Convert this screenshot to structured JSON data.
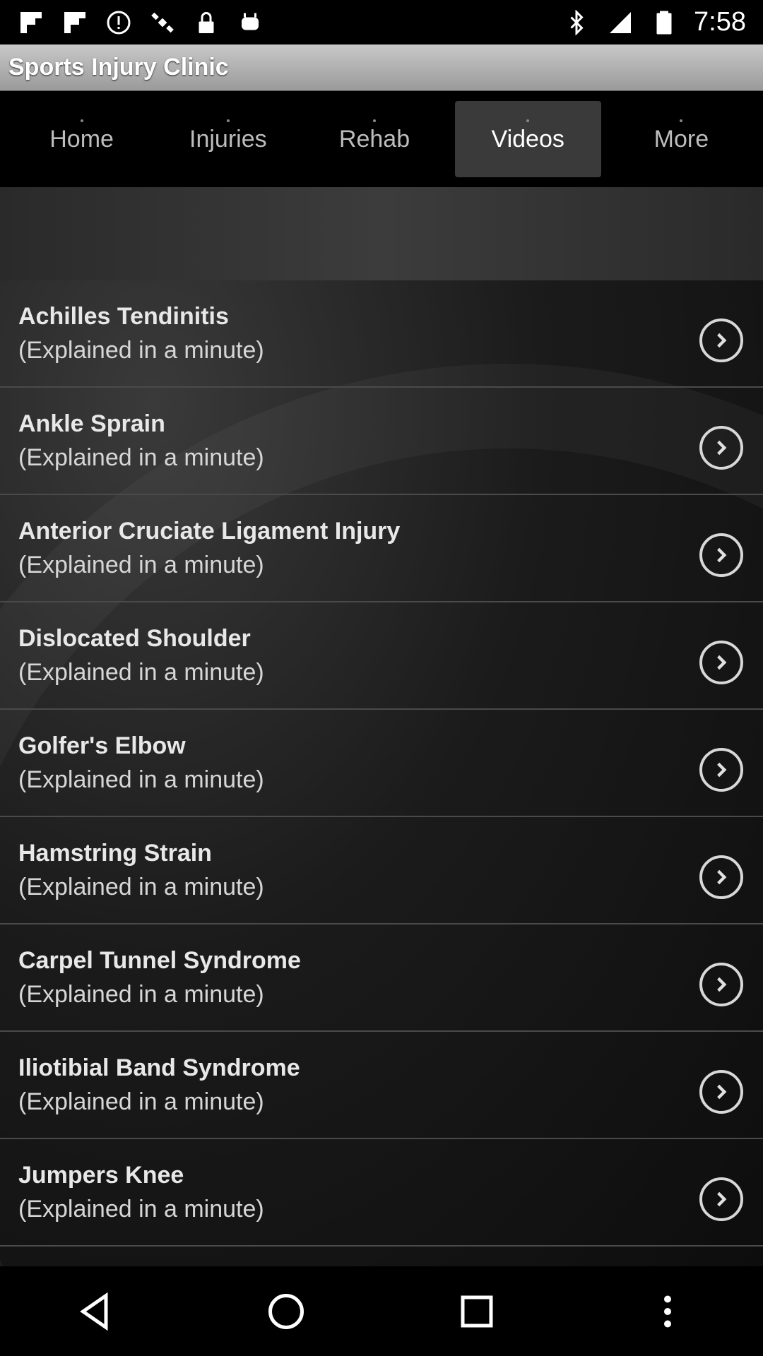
{
  "status_bar": {
    "time": "7:58",
    "left_icons": [
      "flipboard-icon",
      "flipboard-icon",
      "alert-icon",
      "satellite-icon",
      "lock-icon",
      "android-icon"
    ],
    "right_icons": [
      "bluetooth-icon",
      "signal-icon",
      "battery-icon"
    ]
  },
  "app": {
    "title": "Sports Injury Clinic"
  },
  "tabs": [
    {
      "label": "Home",
      "active": false
    },
    {
      "label": "Injuries",
      "active": false
    },
    {
      "label": "Rehab",
      "active": false
    },
    {
      "label": "Videos",
      "active": true
    },
    {
      "label": "More",
      "active": false
    }
  ],
  "videos": [
    {
      "title": "Achilles Tendinitis",
      "subtitle": "(Explained in a minute)"
    },
    {
      "title": "Ankle Sprain",
      "subtitle": "(Explained in a minute)"
    },
    {
      "title": "Anterior Cruciate Ligament Injury",
      "subtitle": "(Explained in a minute)"
    },
    {
      "title": "Dislocated Shoulder",
      "subtitle": "(Explained in a minute)"
    },
    {
      "title": "Golfer's Elbow",
      "subtitle": "(Explained in a minute)"
    },
    {
      "title": "Hamstring Strain",
      "subtitle": "(Explained in a minute)"
    },
    {
      "title": "Carpel Tunnel Syndrome",
      "subtitle": "(Explained in a minute)"
    },
    {
      "title": "Iliotibial Band Syndrome",
      "subtitle": "(Explained in a minute)"
    },
    {
      "title": "Jumpers Knee",
      "subtitle": "(Explained in a minute)"
    }
  ],
  "colors": {
    "active_tab": "#3a3a3a",
    "title_bar": "#b0b0b0",
    "background": "#000000"
  }
}
